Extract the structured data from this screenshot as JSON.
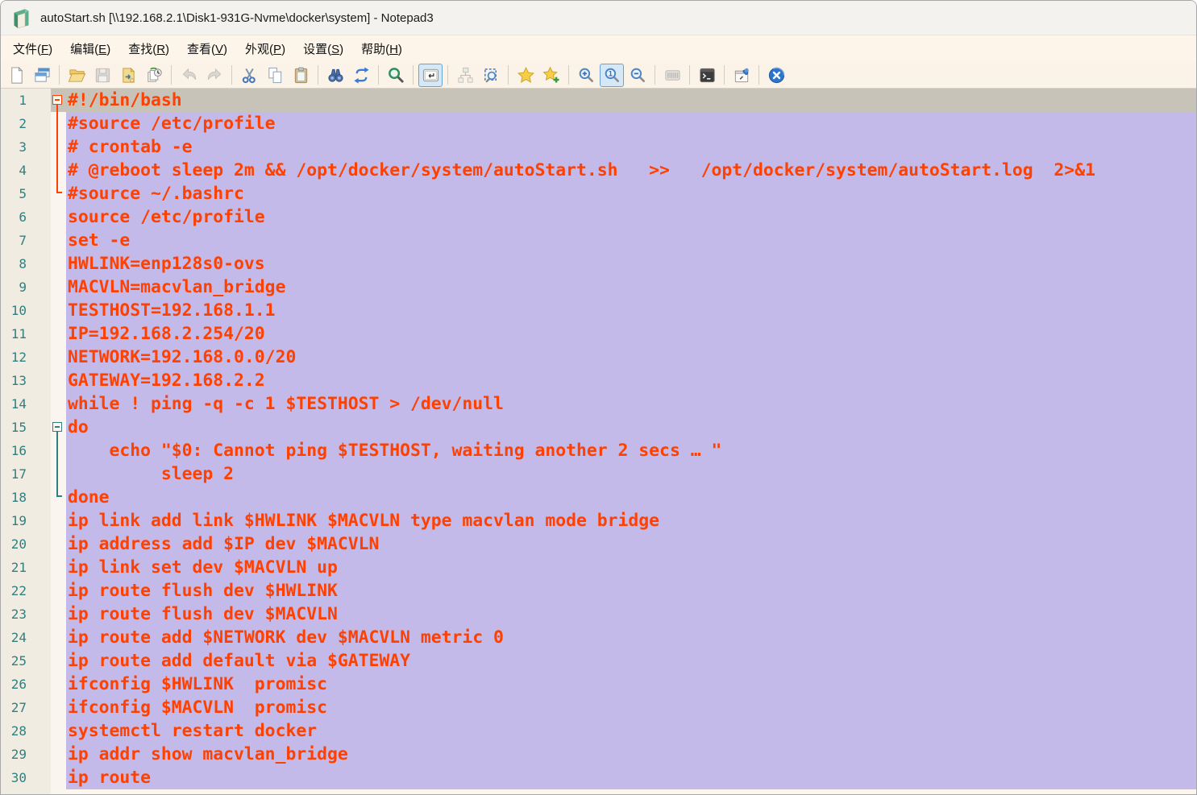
{
  "window": {
    "title": "autoStart.sh [\\\\192.168.2.1\\Disk1-931G-Nvme\\docker\\system] - Notepad3",
    "app_name": "Notepad3"
  },
  "menu": {
    "items": [
      {
        "pre": "文件(",
        "key": "F",
        "post": ")"
      },
      {
        "pre": "编辑(",
        "key": "E",
        "post": ")"
      },
      {
        "pre": "查找(",
        "key": "R",
        "post": ")"
      },
      {
        "pre": "查看(",
        "key": "V",
        "post": ")"
      },
      {
        "pre": "外观(",
        "key": "P",
        "post": ")"
      },
      {
        "pre": "设置(",
        "key": "S",
        "post": ")"
      },
      {
        "pre": "帮助(",
        "key": "H",
        "post": ")"
      }
    ]
  },
  "toolbar": {
    "buttons": [
      {
        "icon": "new-file-icon"
      },
      {
        "icon": "new-window-icon"
      },
      {
        "icon": "open-file-icon"
      },
      {
        "icon": "save-icon",
        "disabled": true
      },
      {
        "icon": "save-as-icon"
      },
      {
        "icon": "recent-files-icon"
      },
      {
        "icon": "undo-icon",
        "disabled": true
      },
      {
        "icon": "redo-icon",
        "disabled": true
      },
      {
        "icon": "cut-icon"
      },
      {
        "icon": "copy-icon"
      },
      {
        "icon": "paste-icon"
      },
      {
        "icon": "find-icon"
      },
      {
        "icon": "replace-icon"
      },
      {
        "icon": "search-magnifier-icon"
      },
      {
        "icon": "word-wrap-icon",
        "pressed": true
      },
      {
        "icon": "scheme-tree-icon",
        "disabled": true
      },
      {
        "icon": "zoom-selection-icon"
      },
      {
        "icon": "favorites-icon"
      },
      {
        "icon": "add-favorite-icon"
      },
      {
        "icon": "zoom-in-icon"
      },
      {
        "icon": "zoom-reset-icon",
        "pressed": true
      },
      {
        "icon": "zoom-out-icon"
      },
      {
        "icon": "whitespace-settings-icon",
        "disabled": true
      },
      {
        "icon": "execute-console-icon"
      },
      {
        "icon": "always-on-top-icon"
      },
      {
        "icon": "exit-icon"
      }
    ]
  },
  "editor": {
    "fold_regions": [
      {
        "from": 1,
        "to": 5,
        "color": "#FF4000"
      },
      {
        "from": 15,
        "to": 18,
        "color": "#2F8080"
      }
    ],
    "lines": [
      {
        "n": "1",
        "code": "#!/bin/bash"
      },
      {
        "n": "2",
        "code": "#source /etc/profile"
      },
      {
        "n": "3",
        "code": "# crontab -e"
      },
      {
        "n": "4",
        "code": "# @reboot sleep 2m && /opt/docker/system/autoStart.sh   >>   /opt/docker/system/autoStart.log  2>&1"
      },
      {
        "n": "5",
        "code": "#source ~/.bashrc"
      },
      {
        "n": "6",
        "code": "source /etc/profile"
      },
      {
        "n": "7",
        "code": "set -e"
      },
      {
        "n": "8",
        "code": "HWLINK=enp128s0-ovs"
      },
      {
        "n": "9",
        "code": "MACVLN=macvlan_bridge"
      },
      {
        "n": "10",
        "code": "TESTHOST=192.168.1.1"
      },
      {
        "n": "11",
        "code": "IP=192.168.2.254/20"
      },
      {
        "n": "12",
        "code": "NETWORK=192.168.0.0/20"
      },
      {
        "n": "13",
        "code": "GATEWAY=192.168.2.2"
      },
      {
        "n": "14",
        "code": "while ! ping -q -c 1 $TESTHOST > /dev/null"
      },
      {
        "n": "15",
        "code": "do"
      },
      {
        "n": "16",
        "code": "    echo \"$0: Cannot ping $TESTHOST, waiting another 2 secs … \""
      },
      {
        "n": "17",
        "code": "         sleep 2"
      },
      {
        "n": "18",
        "code": "done"
      },
      {
        "n": "19",
        "code": "ip link add link $HWLINK $MACVLN type macvlan mode bridge"
      },
      {
        "n": "20",
        "code": "ip address add $IP dev $MACVLN"
      },
      {
        "n": "21",
        "code": "ip link set dev $MACVLN up"
      },
      {
        "n": "22",
        "code": "ip route flush dev $HWLINK"
      },
      {
        "n": "23",
        "code": "ip route flush dev $MACVLN"
      },
      {
        "n": "24",
        "code": "ip route add $NETWORK dev $MACVLN metric 0"
      },
      {
        "n": "25",
        "code": "ip route add default via $GATEWAY"
      },
      {
        "n": "26",
        "code": "ifconfig $HWLINK  promisc"
      },
      {
        "n": "27",
        "code": "ifconfig $MACVLN  promisc"
      },
      {
        "n": "28",
        "code": "systemctl restart docker"
      },
      {
        "n": "29",
        "code": "ip addr show macvlan_bridge"
      },
      {
        "n": "30",
        "code": "ip route"
      }
    ]
  },
  "colors": {
    "code_text": "#FF4000",
    "selection_bg": "#C3BAE9",
    "current_line_bg": "#C8C3B8",
    "gutter_bg": "#F1ECE1",
    "line_number": "#2F8080",
    "editor_bg": "#FDF6ED",
    "chrome_bg": "#FBF3E8",
    "fold_marker_red": "#FF4000",
    "fold_marker_teal": "#2F8080"
  }
}
